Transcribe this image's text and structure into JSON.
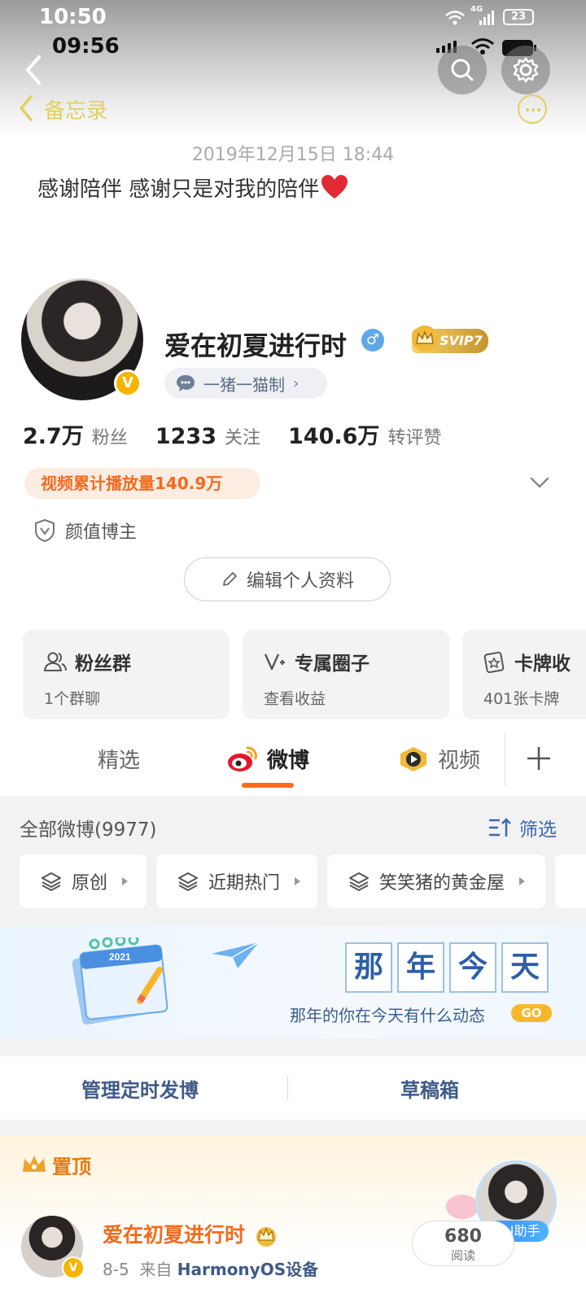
{
  "status_bar": {
    "time_outer": "10:50",
    "time_inner": "09:56",
    "battery": "23",
    "network": "4G"
  },
  "memo": {
    "back_label": "备忘录",
    "date": "2019年12月15日 18:44",
    "text": "感谢陪伴 感谢只是对我的陪伴"
  },
  "profile": {
    "name": "爱在初夏进行时",
    "gender": "♂",
    "vip_label": "SVIP7",
    "verified": "V",
    "tag": "一猪一猫制",
    "stats": [
      {
        "value": "2.7万",
        "label": "粉丝"
      },
      {
        "value": "1233",
        "label": "关注"
      },
      {
        "value": "140.6万",
        "label": "转评赞"
      }
    ],
    "video_plays": "视频累计播放量140.9万",
    "badge": "颜值博主",
    "edit_button": "编辑个人资料"
  },
  "cards": [
    {
      "title": "粉丝群",
      "sub": "1个群聊",
      "icon": "people-icon"
    },
    {
      "title": "专属圈子",
      "sub": "查看收益",
      "icon": "circle-v-icon"
    },
    {
      "title": "卡牌收",
      "sub": "401张卡牌",
      "icon": "card-star-icon"
    }
  ],
  "tabs": [
    {
      "label": "精选",
      "active": false
    },
    {
      "label": "微博",
      "active": true
    },
    {
      "label": "视频",
      "active": false
    }
  ],
  "feed": {
    "all_label": "全部微博(9977)",
    "filter_label": "筛选",
    "chips": [
      "原创",
      "近期热门",
      "笑笑猪的黄金屋"
    ]
  },
  "banner": {
    "chars": [
      "那",
      "年",
      "今",
      "天"
    ],
    "subtitle": "那年的你在今天有什么动态",
    "go": "GO",
    "calendar_year": "2021"
  },
  "manage": {
    "left": "管理定时发博",
    "right": "草稿箱"
  },
  "pinned": {
    "label": "置顶",
    "author": "爱在初夏进行时",
    "meta_date": "8-5",
    "meta_from": "来自",
    "meta_device": "HarmonyOS设备",
    "read_count": "680",
    "read_label": "阅读",
    "ai_label": "+AI助手"
  },
  "colors": {
    "accent_orange": "#ff6a1a",
    "link_blue": "#3f5a86",
    "memo_yellow": "#e2cf63",
    "vip_gold": "#f4b400"
  }
}
